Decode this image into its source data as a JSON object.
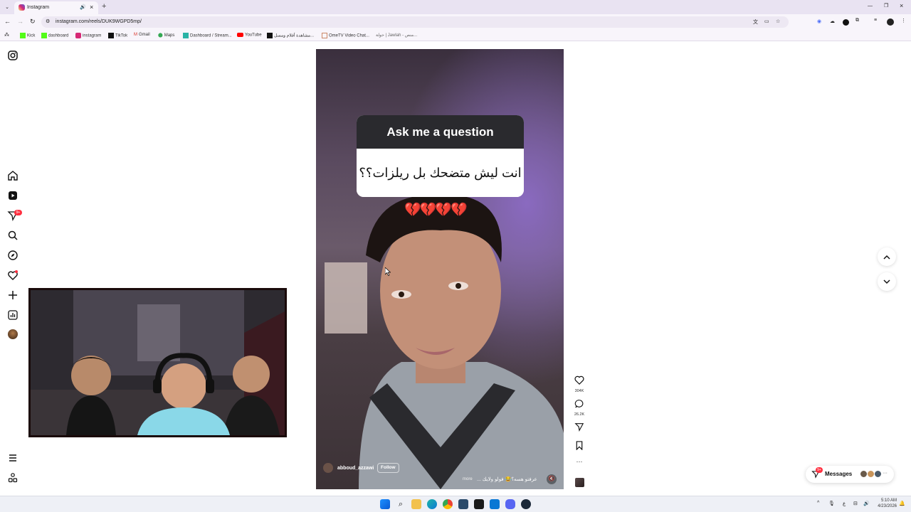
{
  "browser": {
    "tab_title": "Instagram",
    "new_tab_label": "+",
    "url": "instagram.com/reels/DUK9WGPD5mp/",
    "bookmarks": [
      "Kick",
      "dashboard",
      "instagram",
      "TikTok",
      "Gmail",
      "Maps",
      "Dashboard / Stream...",
      "YouTube",
      "مشاهدة أفلام ومسل...",
      "OmeTV Video Chat...",
      "حولة | Jawlah - منص..."
    ]
  },
  "sidebar": {
    "notification_badge": "9+"
  },
  "reel": {
    "question_header": "Ask me a question",
    "question_text": "انت ليش متضحك بل ريلزات؟؟",
    "emoji_row": "💔💔💔💔",
    "username": "abboud_azzawi",
    "follow_label": "Follow",
    "caption": "عرفتو هسه؟😂 فولو ولايك ...",
    "more_label": "more"
  },
  "actions": {
    "likes": "304K",
    "comments": "26.2K",
    "more": "···"
  },
  "messages": {
    "label": "Messages",
    "badge": "9+"
  },
  "taskbar": {
    "time": "5:10 AM",
    "date": "4/23/2026",
    "lang": "ع"
  },
  "colors": {
    "accent": "#ff3040",
    "chrome_bg": "#e9e3f2",
    "question_header_bg": "#2a2a2e"
  }
}
